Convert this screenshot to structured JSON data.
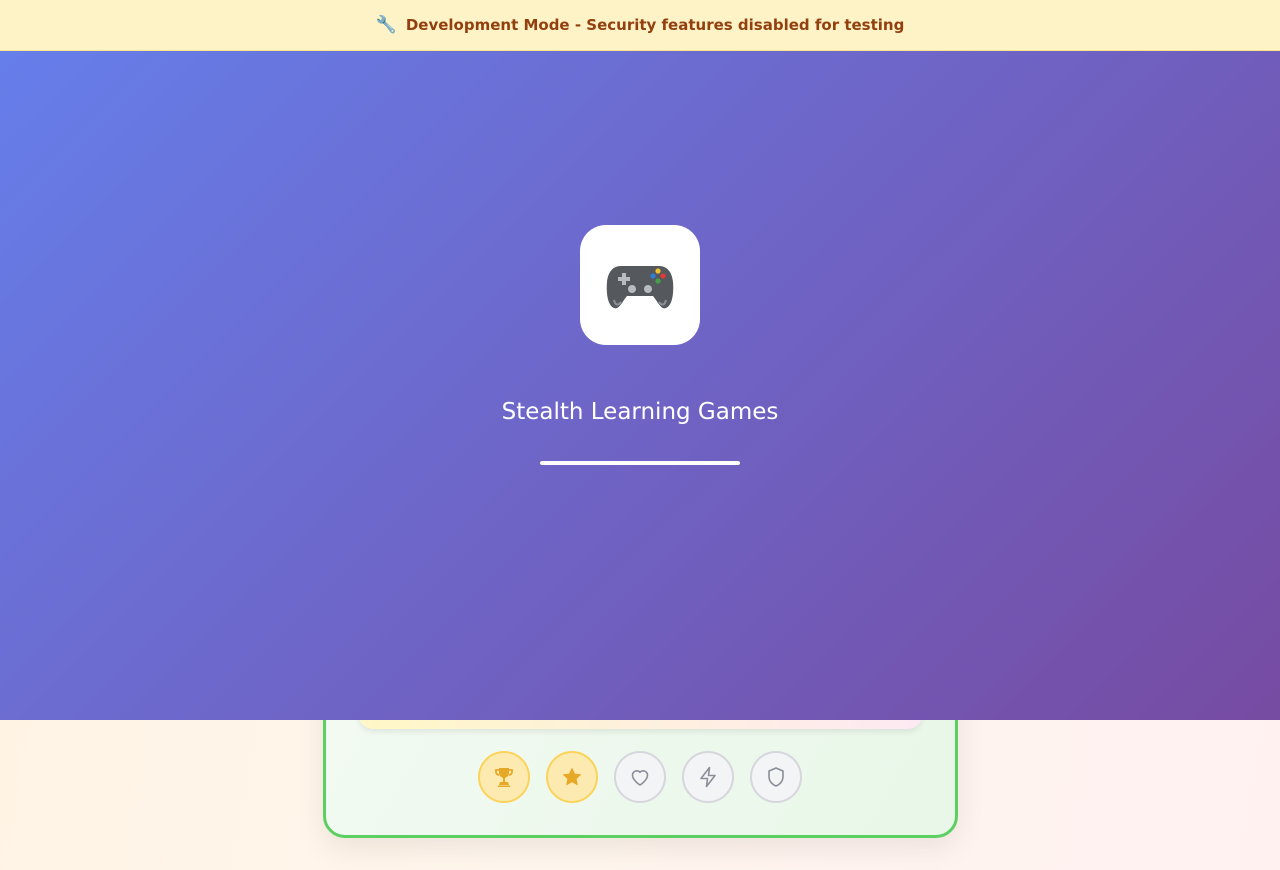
{
  "banner": {
    "icon": "wrench-icon",
    "text": "Development Mode - Security features disabled for testing"
  },
  "loading": {
    "logo_icon": "gamepad-icon",
    "title": "Stealth Learning Games",
    "progress": 1.0
  },
  "badges": [
    {
      "icon": "trophy-icon",
      "earned": true
    },
    {
      "icon": "star-icon",
      "earned": true
    },
    {
      "icon": "heart-icon",
      "earned": false
    },
    {
      "icon": "lightning-icon",
      "earned": false
    },
    {
      "icon": "shield-icon",
      "earned": false
    }
  ],
  "colors": {
    "banner_bg": "#fef3c7",
    "banner_text": "#92400e",
    "overlay_start": "#667eea",
    "overlay_end": "#764ba2",
    "card_border": "#5ccf62",
    "badge_earned": "#e6a827",
    "badge_locked": "#8a8f99"
  }
}
